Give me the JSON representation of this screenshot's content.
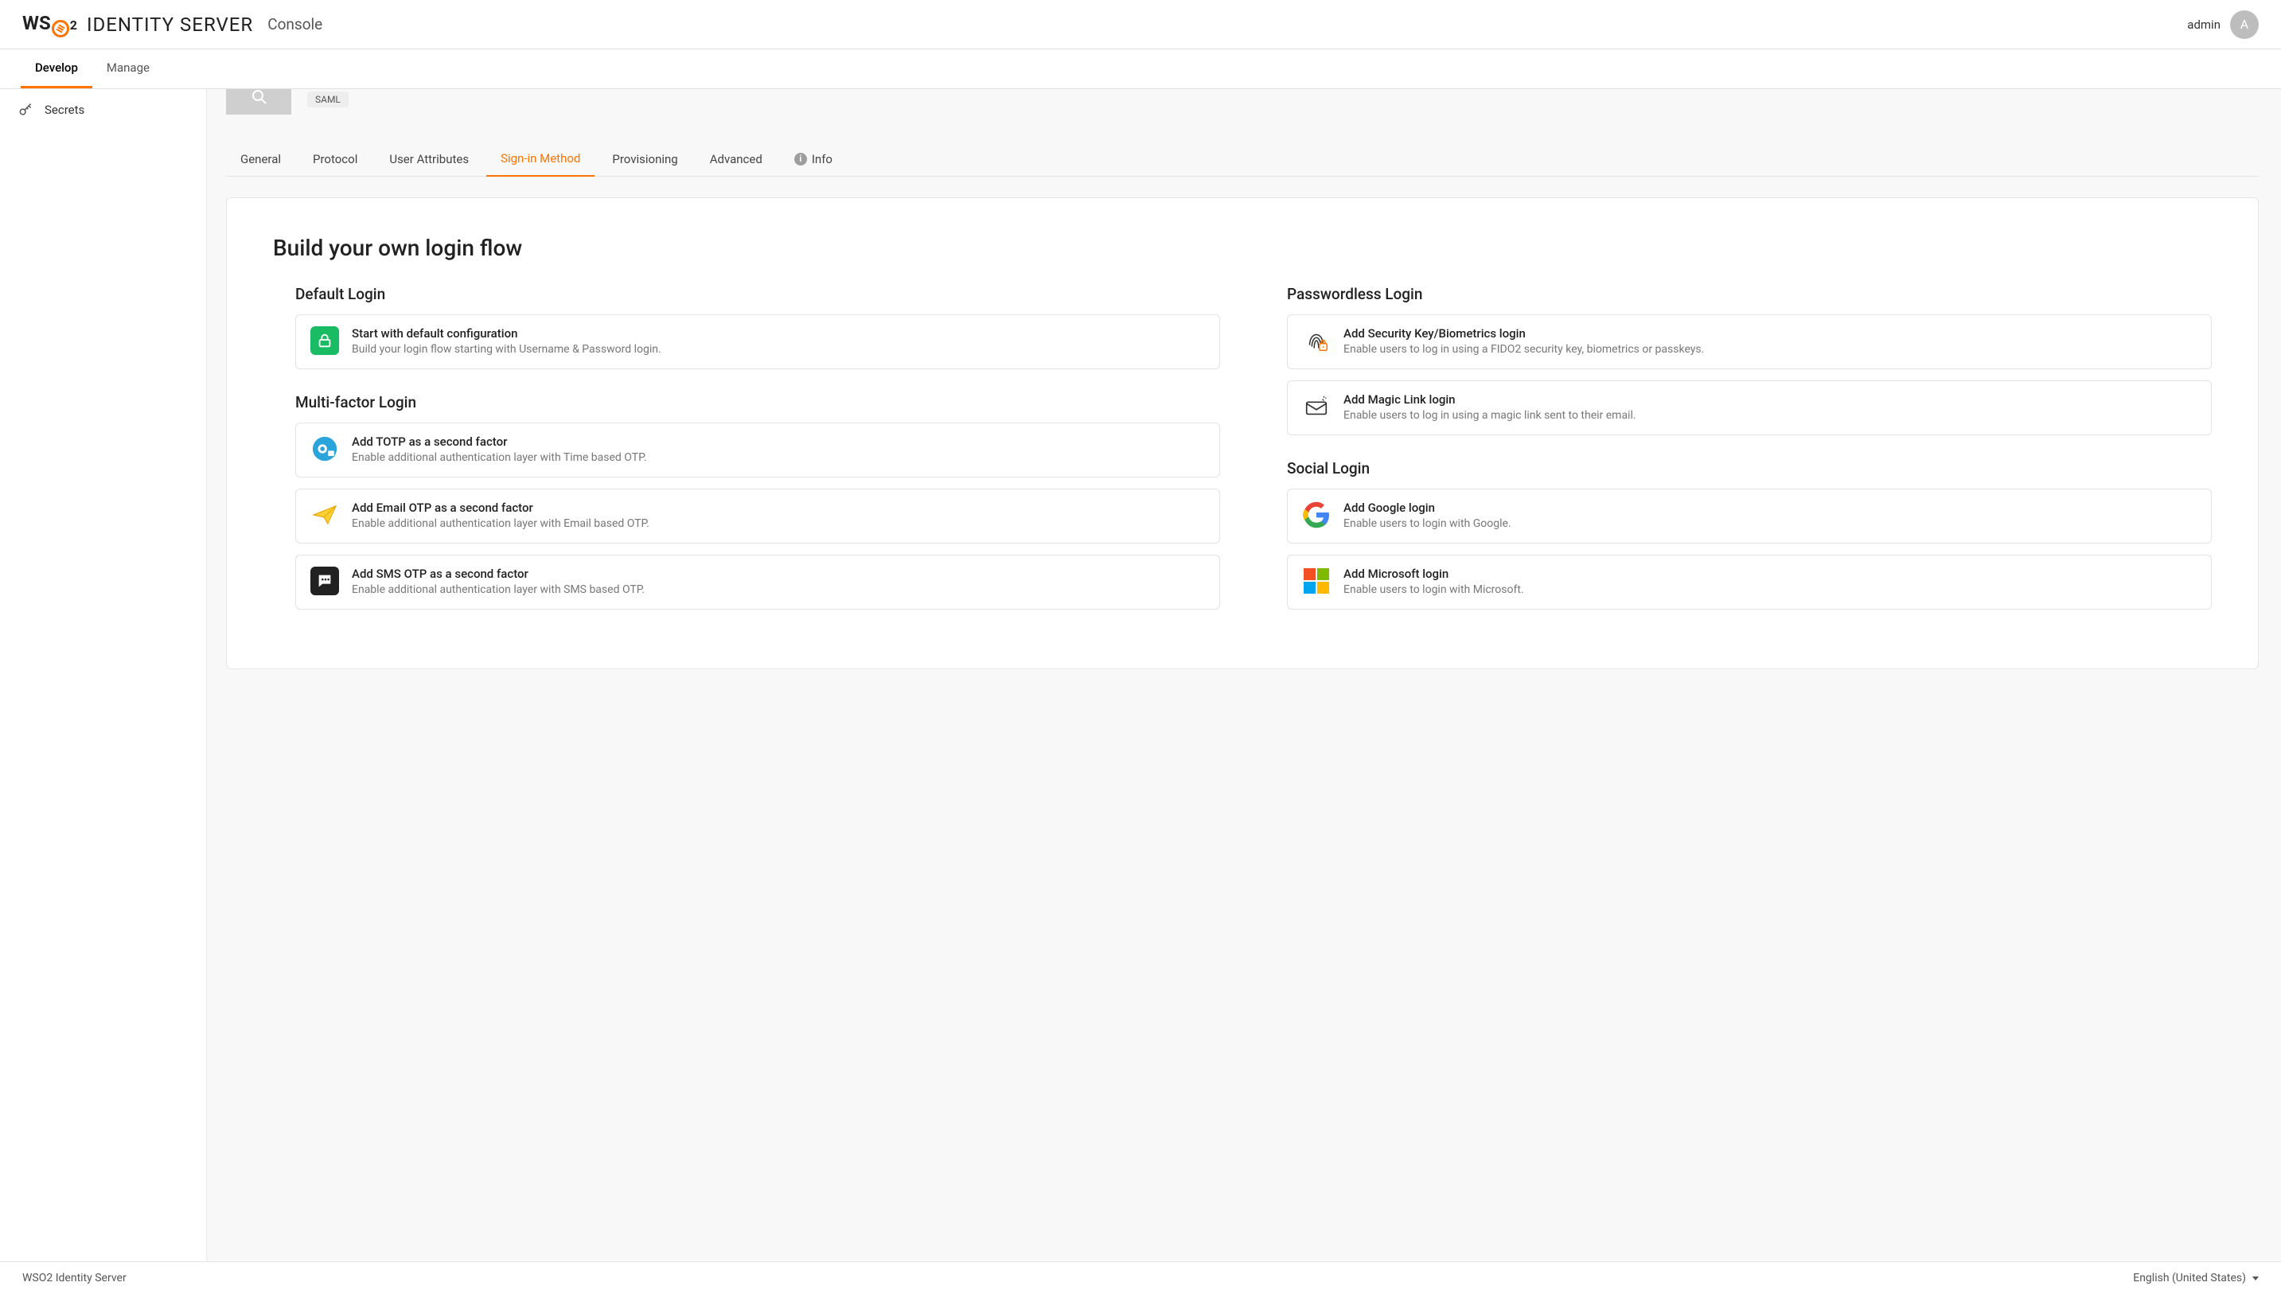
{
  "header": {
    "product": "IDENTITY SERVER",
    "suffix": "Console",
    "username": "admin",
    "avatar_initial": "A"
  },
  "topnav": {
    "tabs": [
      {
        "label": "Develop",
        "active": true
      },
      {
        "label": "Manage",
        "active": false
      }
    ]
  },
  "sidebar": {
    "items": [
      {
        "label": "Secrets"
      }
    ]
  },
  "app": {
    "badge": "SAML"
  },
  "subtabs": [
    {
      "label": "General"
    },
    {
      "label": "Protocol"
    },
    {
      "label": "User Attributes"
    },
    {
      "label": "Sign-in Method",
      "active": true
    },
    {
      "label": "Provisioning"
    },
    {
      "label": "Advanced"
    },
    {
      "label": "Info",
      "has_icon": true
    }
  ],
  "panel": {
    "title": "Build your own login flow",
    "sections": {
      "default": {
        "title": "Default Login",
        "options": [
          {
            "title": "Start with default configuration",
            "desc": "Build your login flow starting with Username & Password login."
          }
        ]
      },
      "mfa": {
        "title": "Multi-factor Login",
        "options": [
          {
            "title": "Add TOTP as a second factor",
            "desc": "Enable additional authentication layer with Time based OTP."
          },
          {
            "title": "Add Email OTP as a second factor",
            "desc": "Enable additional authentication layer with Email based OTP."
          },
          {
            "title": "Add SMS OTP as a second factor",
            "desc": "Enable additional authentication layer with SMS based OTP."
          }
        ]
      },
      "passwordless": {
        "title": "Passwordless Login",
        "options": [
          {
            "title": "Add Security Key/Biometrics login",
            "desc": "Enable users to log in using a FIDO2 security key, biometrics or passkeys."
          },
          {
            "title": "Add Magic Link login",
            "desc": "Enable users to log in using a magic link sent to their email."
          }
        ]
      },
      "social": {
        "title": "Social Login",
        "options": [
          {
            "title": "Add Google login",
            "desc": "Enable users to login with Google."
          },
          {
            "title": "Add Microsoft login",
            "desc": "Enable users to login with Microsoft."
          }
        ]
      }
    }
  },
  "footer": {
    "product": "WSO2 Identity Server",
    "language": "English (United States)"
  }
}
